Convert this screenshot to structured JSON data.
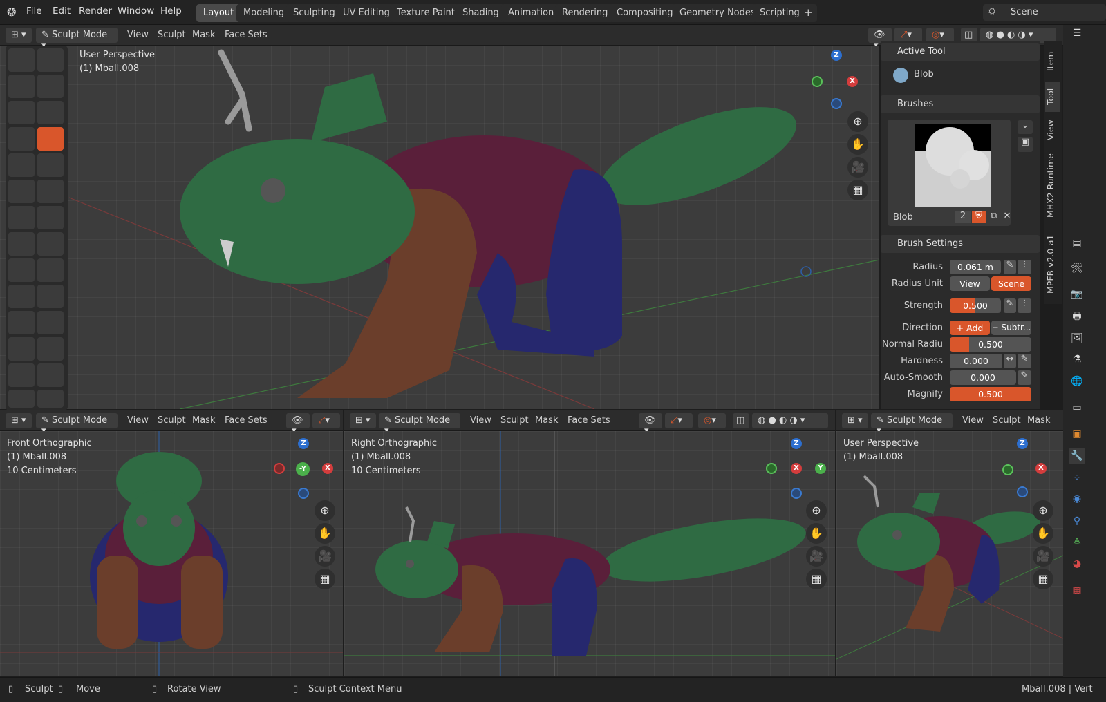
{
  "topbar": {
    "menus": [
      "File",
      "Edit",
      "Render",
      "Window",
      "Help"
    ],
    "workspaces": [
      "Layout",
      "Modeling",
      "Sculpting",
      "UV Editing",
      "Texture Paint",
      "Shading",
      "Animation",
      "Rendering",
      "Compositing",
      "Geometry Nodes",
      "Scripting"
    ],
    "add_tab": "+",
    "scene_label": "Scene"
  },
  "main_header": {
    "mode": "Sculpt Mode",
    "menus": [
      "View",
      "Sculpt",
      "Mask",
      "Face Sets"
    ]
  },
  "main_view": {
    "line1": "User Perspective",
    "line2": "(1) Mball.008"
  },
  "gizmo": {
    "z": "Z",
    "x": "X",
    "y": "Y",
    "neg_y": "-Y"
  },
  "sidebar": {
    "active_tool_title": "Active Tool",
    "tool_name": "Blob",
    "brushes_title": "Brushes",
    "brush_name": "Blob",
    "brush_users": "2",
    "brush_settings_title": "Brush Settings",
    "radius_label": "Radius",
    "radius_value": "0.061 m",
    "radius_unit_label": "Radius Unit",
    "radius_unit_view": "View",
    "radius_unit_scene": "Scene",
    "strength_label": "Strength",
    "strength_value": "0.500",
    "strength_fill": 0.5,
    "direction_label": "Direction",
    "direction_add": "+ Add",
    "direction_sub": "− Subtr...",
    "normal_radius_label": "Normal Radiu",
    "normal_radius_value": "0.500",
    "hardness_label": "Hardness",
    "hardness_value": "0.000",
    "autosmooth_label": "Auto-Smooth",
    "autosmooth_value": "0.000",
    "magnify_label": "Magnify",
    "magnify_value": "0.500"
  },
  "side_tabs": [
    "Item",
    "Tool",
    "View",
    "MHX2 Runtime",
    "MPFB v2.0-a1"
  ],
  "bottom_views": [
    {
      "mode": "Sculpt Mode",
      "menus": [
        "View",
        "Sculpt",
        "Mask",
        "Face Sets"
      ],
      "line1": "Front Orthographic",
      "line2": "(1) Mball.008",
      "line3": "10 Centimeters"
    },
    {
      "mode": "Sculpt Mode",
      "menus": [
        "View",
        "Sculpt",
        "Mask",
        "Face Sets"
      ],
      "line1": "Right Orthographic",
      "line2": "(1) Mball.008",
      "line3": "10 Centimeters"
    },
    {
      "mode": "Sculpt Mode",
      "menus": [
        "View",
        "Sculpt",
        "Mask"
      ],
      "line1": "User Perspective",
      "line2": "(1) Mball.008"
    }
  ],
  "status": {
    "sculpt": "Sculpt",
    "move": "Move",
    "rotate": "Rotate View",
    "context": "Sculpt Context Menu",
    "right": "Mball.008 | Vert"
  },
  "colors": {
    "accent": "#d9562b",
    "green_body": "#2f6b43",
    "maroon_body": "#5a1f3a",
    "brown_body": "#6b3e2b",
    "blue_body": "#26286e"
  }
}
